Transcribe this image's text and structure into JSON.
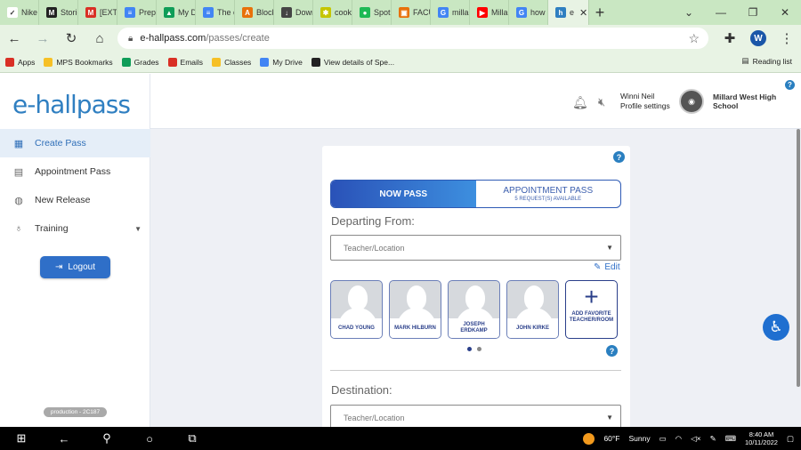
{
  "browser": {
    "tabs": [
      {
        "label": "Nike",
        "fav_color": "#ffffff",
        "fav_text": "✓"
      },
      {
        "label": "Storie",
        "fav_color": "#222222",
        "fav_text": "M"
      },
      {
        "label": "[EXTE",
        "fav_color": "#d93025",
        "fav_text": "M"
      },
      {
        "label": "Prep",
        "fav_color": "#4285f4",
        "fav_text": "≡"
      },
      {
        "label": "My D",
        "fav_color": "#0f9d58",
        "fav_text": "▲"
      },
      {
        "label": "The cl",
        "fav_color": "#4285f4",
        "fav_text": "≡"
      },
      {
        "label": "Block",
        "fav_color": "#e8710a",
        "fav_text": "A"
      },
      {
        "label": "Down",
        "fav_color": "#444444",
        "fav_text": "↓"
      },
      {
        "label": "cooki",
        "fav_color": "#c5c500",
        "fav_text": "✱"
      },
      {
        "label": "Spoti",
        "fav_color": "#1db954",
        "fav_text": "●"
      },
      {
        "label": "FACUI",
        "fav_color": "#e8710a",
        "fav_text": "▣"
      },
      {
        "label": "millar",
        "fav_color": "#4285f4",
        "fav_text": "G"
      },
      {
        "label": "Millar",
        "fav_color": "#ff0000",
        "fav_text": "▶"
      },
      {
        "label": "how t",
        "fav_color": "#4285f4",
        "fav_text": "G"
      }
    ],
    "active_tab_label": "e",
    "url_host": "e-hallpass.com",
    "url_path": "/passes/create",
    "profile_initial": "W",
    "bookmarks": [
      {
        "label": "Apps",
        "color": "#d93025"
      },
      {
        "label": "MPS Bookmarks",
        "color": "#f6c026"
      },
      {
        "label": "Grades",
        "color": "#0f9d58"
      },
      {
        "label": "Emails",
        "color": "#d93025"
      },
      {
        "label": "Classes",
        "color": "#f6c026"
      },
      {
        "label": "My Drive",
        "color": "#4285f4"
      },
      {
        "label": "View details of Spe...",
        "color": "#222222"
      }
    ],
    "reading_list": "Reading list"
  },
  "sidebar": {
    "logo": "e-hallpass",
    "items": [
      {
        "label": "Create Pass",
        "icon": "grid-icon",
        "glyph": "▦"
      },
      {
        "label": "Appointment Pass",
        "icon": "calendar-icon",
        "glyph": "▤"
      },
      {
        "label": "New Release",
        "icon": "globe-icon",
        "glyph": "◍"
      },
      {
        "label": "Training",
        "icon": "training-icon",
        "glyph": "♁"
      }
    ],
    "logout": "Logout",
    "version": "production - 2C187"
  },
  "header": {
    "user_name": "Winni Neil",
    "profile_settings": "Profile settings",
    "school_line1": "Millard West High",
    "school_line2": "School"
  },
  "pass_form": {
    "now_pass": "NOW PASS",
    "appointment_pass": "APPOINTMENT PASS",
    "appointment_sub": "5 REQUEST(S) AVAILABLE",
    "departing_label": "Departing From:",
    "departing_placeholder": "Teacher/Location",
    "edit": "Edit",
    "favorites": [
      {
        "name": "CHAD YOUNG"
      },
      {
        "name": "MARK HILBURN"
      },
      {
        "name": "JOSEPH ERDKAMP"
      },
      {
        "name": "JOHN KIRKE"
      }
    ],
    "add_favorite": "ADD FAVORITE TEACHER/ROOM",
    "destination_label": "Destination:",
    "destination_placeholder": "Teacher/Location"
  },
  "taskbar": {
    "temperature": "60°F",
    "weather": "Sunny",
    "time": "8:40 AM",
    "date": "10/11/2022"
  }
}
